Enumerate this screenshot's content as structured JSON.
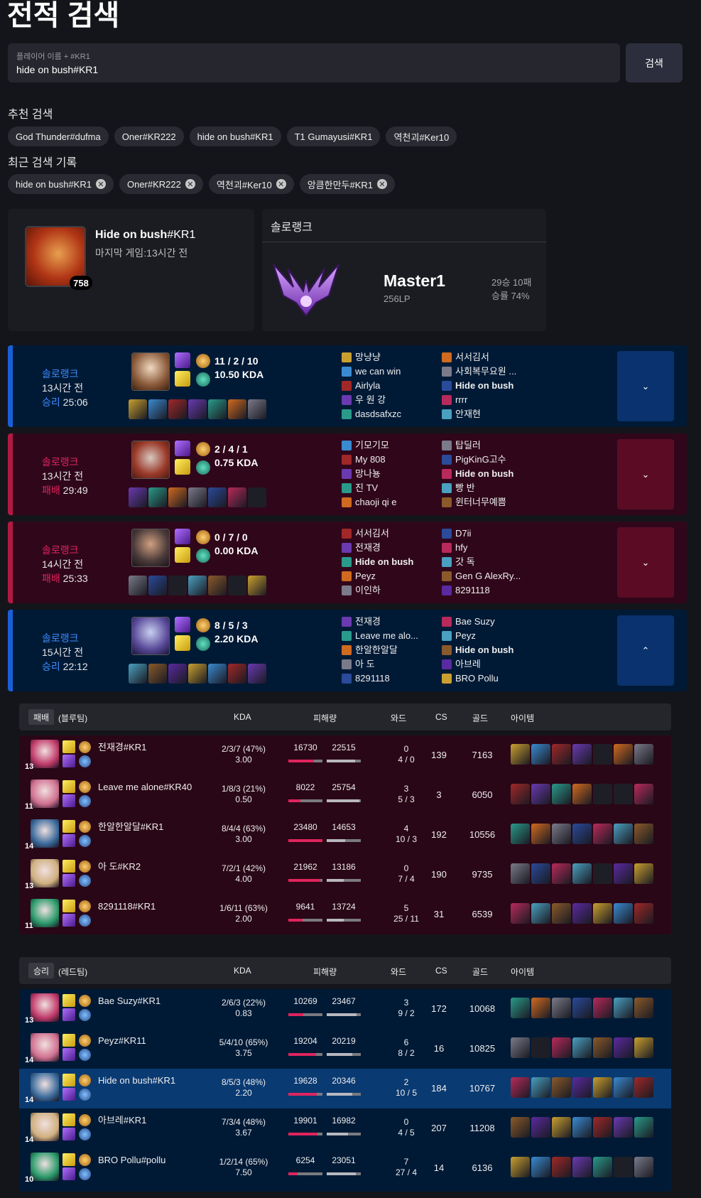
{
  "page": {
    "title": "전적 검색"
  },
  "search": {
    "placeholder": "플레이어 이름 + #KR1",
    "value": "hide on bush#KR1",
    "button": "검색"
  },
  "recommend": {
    "label": "추천 검색",
    "items": [
      "God Thunder#dufma",
      "Oner#KR222",
      "hide on bush#KR1",
      "T1 Gumayusi#KR1",
      "역천괴#Ker10"
    ]
  },
  "recent": {
    "label": "최근 검색 기록",
    "items": [
      "hide on bush#KR1",
      "Oner#KR222",
      "역천괴#Ker10",
      "앙큼한만두#KR1"
    ]
  },
  "profile": {
    "name": "Hide on bush",
    "tag": "#KR1",
    "last_game": "마지막 게임:13시간 전",
    "level": "758"
  },
  "rank": {
    "header": "솔로랭크",
    "tier": "Master1",
    "lp": "256LP",
    "wl": "29승 10패",
    "winrate": "승률 74%"
  },
  "matches": [
    {
      "result": "win",
      "queue": "솔로랭크",
      "ago": "13시간 전",
      "result_label": "승리",
      "duration": "25:06",
      "kda_score": "11 / 2 / 10",
      "kda": "10.50 KDA",
      "team1": [
        "망냥냥",
        "we can win",
        "Airlyla",
        "우 원 강",
        "dasdsafxzc"
      ],
      "team2": [
        "서서김서",
        "사회복무요원 ...",
        "Hide on bush",
        "rrrr",
        "안재현"
      ],
      "expand": "⌄"
    },
    {
      "result": "lose",
      "queue": "솔로랭크",
      "ago": "13시간 전",
      "result_label": "패배",
      "duration": "29:49",
      "kda_score": "2 / 4 / 1",
      "kda": "0.75 KDA",
      "team1": [
        "기모기모",
        "My 808",
        "망나뇽",
        "진 TV",
        "chaoji qi e"
      ],
      "team2": [
        "탑딜러",
        "PigKinG고수",
        "Hide on bush",
        "빵 반",
        "윈터너무예쁨"
      ],
      "expand": "⌄"
    },
    {
      "result": "lose",
      "queue": "솔로랭크",
      "ago": "14시간 전",
      "result_label": "패배",
      "duration": "25:33",
      "kda_score": "0 / 7 / 0",
      "kda": "0.00 KDA",
      "team1": [
        "서서김서",
        "전재경",
        "Hide on bush",
        "Peyz",
        "이인하"
      ],
      "team2": [
        "D7ii",
        "hfy",
        "갓 독",
        "Gen G AlexRy...",
        "8291118"
      ],
      "expand": "⌄"
    },
    {
      "result": "win",
      "queue": "솔로랭크",
      "ago": "15시간 전",
      "result_label": "승리",
      "duration": "22:12",
      "kda_score": "8 / 5 / 3",
      "kda": "2.20 KDA",
      "team1": [
        "전재경",
        "Leave me alo...",
        "한알한알달",
        "아 도",
        "8291118"
      ],
      "team2": [
        "Bae Suzy",
        "Peyz",
        "Hide on bush",
        "아브레",
        "BRO Pollu"
      ],
      "expand": "⌃"
    }
  ],
  "headers": {
    "kda": "KDA",
    "damage": "피해량",
    "ward": "와드",
    "cs": "CS",
    "gold": "골드",
    "items": "아이템"
  },
  "blue_team": {
    "tag": "패배",
    "label": "(블루팀)",
    "players": [
      {
        "name": "전재경#KR1",
        "level": "13",
        "kda_score": "2/3/7 (47%)",
        "kda": "3.00",
        "dmg_dealt": "16730",
        "dmg_taken": "22515",
        "dealt_pct": 0.74,
        "taken_pct": 0.83,
        "wards": "0",
        "ward_detail": "4 / 0",
        "cs": "139",
        "gold": "7163"
      },
      {
        "name": "Leave me alone#KR40",
        "level": "11",
        "kda_score": "1/8/3 (21%)",
        "kda": "0.50",
        "dmg_dealt": "8022",
        "dmg_taken": "25754",
        "dealt_pct": 0.35,
        "taken_pct": 0.95,
        "wards": "3",
        "ward_detail": "5 / 3",
        "cs": "3",
        "gold": "6050"
      },
      {
        "name": "한알한알달#KR1",
        "level": "14",
        "kda_score": "8/4/4 (63%)",
        "kda": "3.00",
        "dmg_dealt": "23480",
        "dmg_taken": "14653",
        "dealt_pct": 1.0,
        "taken_pct": 0.54,
        "wards": "4",
        "ward_detail": "10 / 3",
        "cs": "192",
        "gold": "10556"
      },
      {
        "name": "아 도#KR2",
        "level": "13",
        "kda_score": "7/2/1 (42%)",
        "kda": "4.00",
        "dmg_dealt": "21962",
        "dmg_taken": "13186",
        "dealt_pct": 0.94,
        "taken_pct": 0.49,
        "wards": "0",
        "ward_detail": "7 / 4",
        "cs": "190",
        "gold": "9735"
      },
      {
        "name": "8291118#KR1",
        "level": "11",
        "kda_score": "1/6/11 (63%)",
        "kda": "2.00",
        "dmg_dealt": "9641",
        "dmg_taken": "13724",
        "dealt_pct": 0.41,
        "taken_pct": 0.51,
        "wards": "5",
        "ward_detail": "25 / 11",
        "cs": "31",
        "gold": "6539"
      }
    ]
  },
  "red_team": {
    "tag": "승리",
    "label": "(레드팀)",
    "players": [
      {
        "name": "Bae Suzy#KR1",
        "level": "13",
        "kda_score": "2/6/3 (22%)",
        "kda": "0.83",
        "dmg_dealt": "10269",
        "dmg_taken": "23467",
        "dealt_pct": 0.44,
        "taken_pct": 0.87,
        "wards": "3",
        "ward_detail": "9 / 2",
        "cs": "172",
        "gold": "10068"
      },
      {
        "name": "Peyz#KR11",
        "level": "14",
        "kda_score": "5/4/10 (65%)",
        "kda": "3.75",
        "dmg_dealt": "19204",
        "dmg_taken": "20219",
        "dealt_pct": 0.82,
        "taken_pct": 0.75,
        "wards": "6",
        "ward_detail": "8 / 2",
        "cs": "16",
        "gold": "10825"
      },
      {
        "name": "Hide on bush#KR1",
        "level": "14",
        "kda_score": "8/5/3 (48%)",
        "kda": "2.20",
        "dmg_dealt": "19628",
        "dmg_taken": "20346",
        "dealt_pct": 0.84,
        "taken_pct": 0.76,
        "wards": "2",
        "ward_detail": "10 / 5",
        "cs": "184",
        "gold": "10767",
        "me": true
      },
      {
        "name": "아브레#KR1",
        "level": "14",
        "kda_score": "7/3/4 (48%)",
        "kda": "3.67",
        "dmg_dealt": "19901",
        "dmg_taken": "16982",
        "dealt_pct": 0.85,
        "taken_pct": 0.63,
        "wards": "0",
        "ward_detail": "4 / 5",
        "cs": "207",
        "gold": "11208"
      },
      {
        "name": "BRO Pollu#pollu",
        "level": "10",
        "kda_score": "1/2/14 (65%)",
        "kda": "7.50",
        "dmg_dealt": "6254",
        "dmg_taken": "23051",
        "dealt_pct": 0.27,
        "taken_pct": 0.86,
        "wards": "7",
        "ward_detail": "27 / 4",
        "cs": "14",
        "gold": "6136"
      }
    ]
  },
  "colors": {
    "win": "#3d8bff",
    "lose": "#e0245e",
    "win_bg": "#001a36",
    "lose_bg": "#30071a"
  }
}
